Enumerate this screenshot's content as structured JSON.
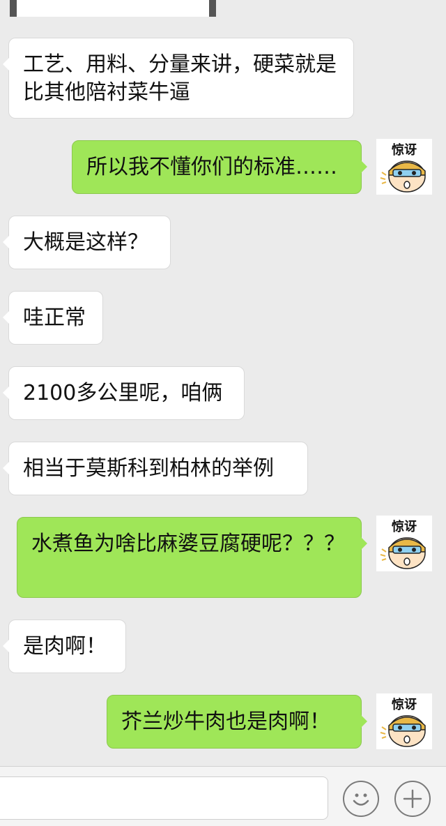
{
  "messages": [
    {
      "side": "left",
      "text": "工艺、用料、分量来讲，硬菜就是比其他陪衬菜牛逼"
    },
    {
      "side": "right",
      "text": "所以我不懂你们的标准……"
    },
    {
      "side": "left",
      "text": "大概是这样？"
    },
    {
      "side": "left",
      "text": "哇正常"
    },
    {
      "side": "left",
      "text": "2100多公里呢，咱俩"
    },
    {
      "side": "left",
      "text": "相当于莫斯科到柏林的举例"
    },
    {
      "side": "right",
      "text": "水煮鱼为啥比麻婆豆腐硬呢？？？"
    },
    {
      "side": "left",
      "text": "是肉啊！"
    },
    {
      "side": "right",
      "text": "芥兰炒牛肉也是肉啊！"
    }
  ],
  "avatar": {
    "caption": "惊讶",
    "icon": "surprised-cartoon-boy-avatar"
  },
  "input_bar": {
    "emoji_icon": "emoji-face-icon",
    "add_icon": "plus-icon"
  },
  "colors": {
    "background": "#ebebeb",
    "bubble_left": "#ffffff",
    "bubble_right": "#9fe658"
  }
}
